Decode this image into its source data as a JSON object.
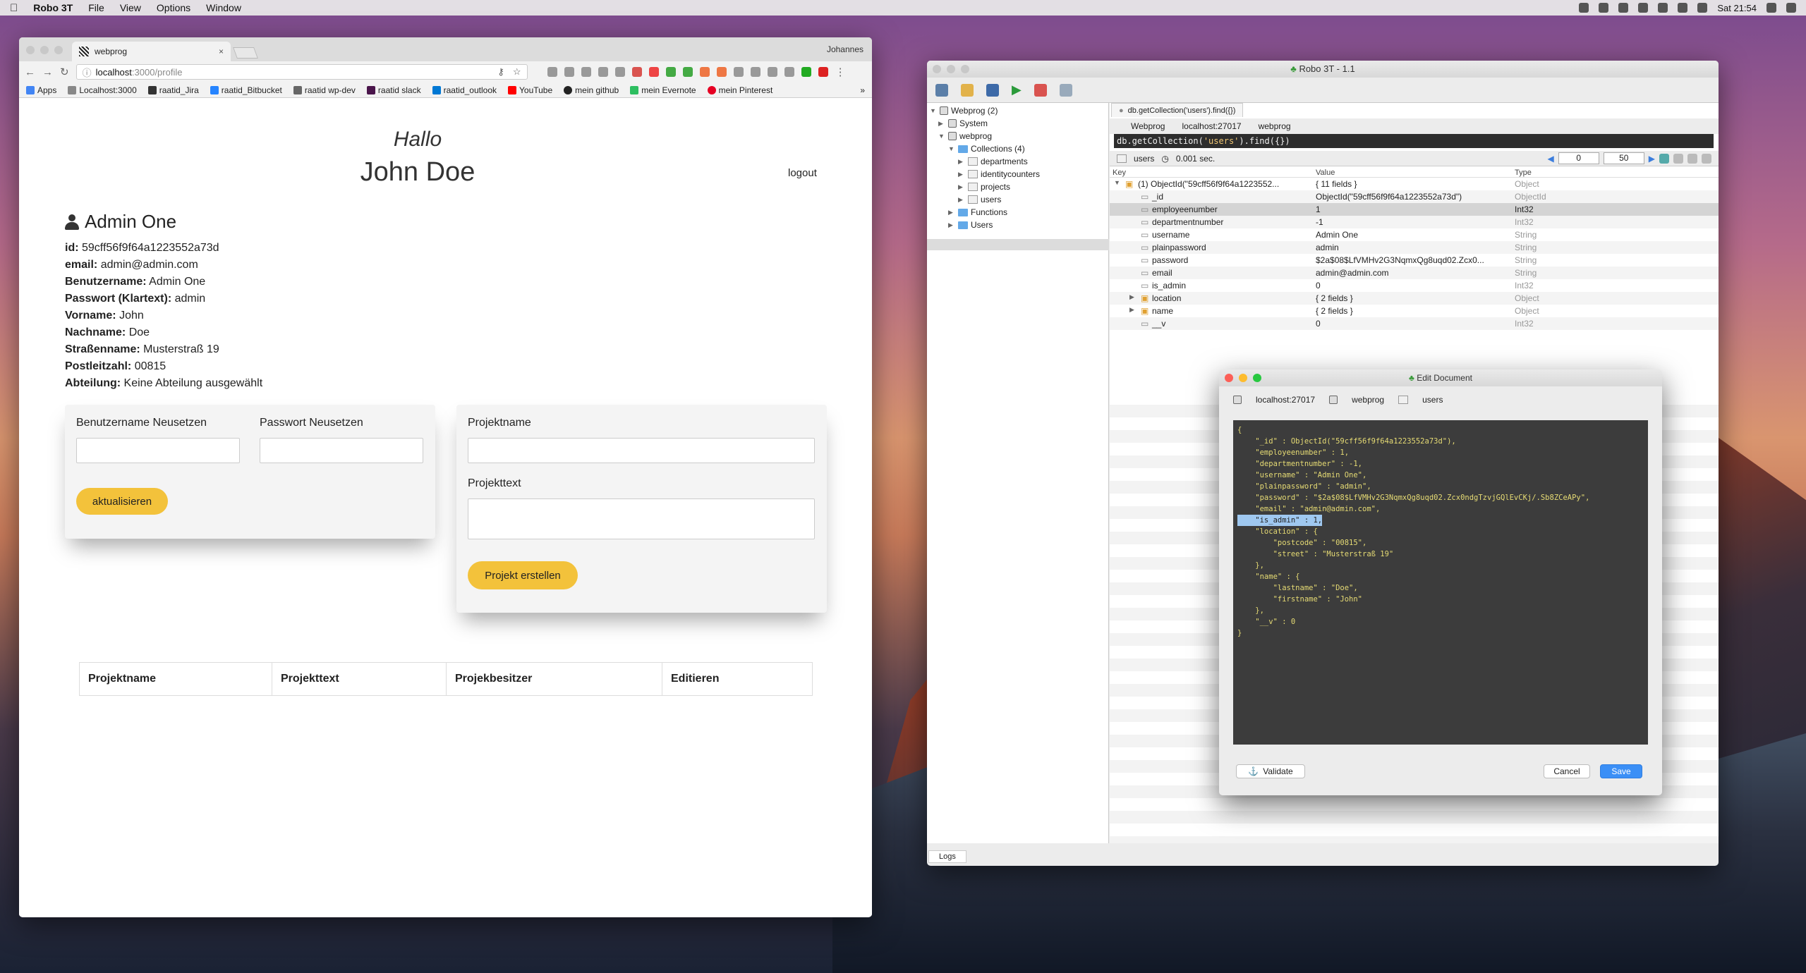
{
  "menubar": {
    "app": "Robo 3T",
    "items": [
      "File",
      "View",
      "Options",
      "Window"
    ],
    "clock": "Sat 21:54"
  },
  "browser": {
    "tab_title": "webprog",
    "user": "Johannes",
    "url_host": "localhost",
    "url_path": ":3000/profile",
    "bookmarks": [
      "Apps",
      "Localhost:3000",
      "raatid_Jira",
      "raatid_Bitbucket",
      "raatid wp-dev",
      "raatid slack",
      "raatid_outlook",
      "YouTube",
      "mein github",
      "mein Evernote",
      "mein Pinterest"
    ],
    "bookmark_colors": [
      "#4285f4",
      "#888888",
      "#333333",
      "#2684ff",
      "#666666",
      "#4a154b",
      "#0078d4",
      "#ff0000",
      "#222222",
      "#2dbe60",
      "#e60023"
    ]
  },
  "profile_page": {
    "greeting": "Hallo",
    "user_name": "John Doe",
    "logout": "logout",
    "heading": "Admin One",
    "fields": [
      {
        "label": "id:",
        "value": "59cff56f9f64a1223552a73d"
      },
      {
        "label": "email:",
        "value": "admin@admin.com"
      },
      {
        "label": "Benutzername:",
        "value": "Admin One"
      },
      {
        "label": "Passwort (Klartext):",
        "value": "admin"
      },
      {
        "label": "Vorname:",
        "value": "John"
      },
      {
        "label": "Nachname:",
        "value": "Doe"
      },
      {
        "label": "Straßenname:",
        "value": "Musterstraß 19"
      },
      {
        "label": "Postleitzahl:",
        "value": "00815"
      },
      {
        "label": "Abteilung:",
        "value": "Keine Abteilung ausgewählt"
      }
    ],
    "reset_form": {
      "username_label": "Benutzername Neusetzen",
      "password_label": "Passwort Neusetzen",
      "button": "aktualisieren"
    },
    "project_form": {
      "name_label": "Projektname",
      "text_label": "Projekttext",
      "button": "Projekt erstellen"
    },
    "table_headers": [
      "Projektname",
      "Projekttext",
      "Projekbesitzer",
      "Editieren"
    ]
  },
  "robo": {
    "title": "Robo 3T - 1.1",
    "tree": {
      "root": "Webprog (2)",
      "system": "System",
      "db": "webprog",
      "collections": "Collections (4)",
      "collection_items": [
        "departments",
        "identitycounters",
        "projects",
        "users"
      ],
      "functions": "Functions",
      "users": "Users"
    },
    "tab": "db.getCollection('users').find({})",
    "crumbs": [
      "Webprog",
      "localhost:27017",
      "webprog"
    ],
    "query_prefix": "db.getCollection(",
    "query_arg": "'users'",
    "query_suffix": ").find({})",
    "status_collection": "users",
    "status_time": "0.001 sec.",
    "pager_from": "0",
    "pager_to": "50",
    "columns": [
      "Key",
      "Value",
      "Type"
    ],
    "rows": [
      {
        "key": "(1) ObjectId(\"59cff56f9f64a1223552...",
        "value": "{ 11 fields }",
        "type": "Object"
      },
      {
        "key": "_id",
        "value": "ObjectId(\"59cff56f9f64a1223552a73d\")",
        "type": "ObjectId"
      },
      {
        "key": "employeenumber",
        "value": "1",
        "type": "Int32"
      },
      {
        "key": "departmentnumber",
        "value": "-1",
        "type": "Int32"
      },
      {
        "key": "username",
        "value": "Admin One",
        "type": "String"
      },
      {
        "key": "plainpassword",
        "value": "admin",
        "type": "String"
      },
      {
        "key": "password",
        "value": "$2a$08$LfVMHv2G3NqmxQg8uqd02.Zcx0...",
        "type": "String"
      },
      {
        "key": "email",
        "value": "admin@admin.com",
        "type": "String"
      },
      {
        "key": "is_admin",
        "value": "0",
        "type": "Int32"
      },
      {
        "key": "location",
        "value": "{ 2 fields }",
        "type": "Object"
      },
      {
        "key": "name",
        "value": "{ 2 fields }",
        "type": "Object"
      },
      {
        "key": "__v",
        "value": "0",
        "type": "Int32"
      }
    ],
    "logs": "Logs"
  },
  "dialog": {
    "title": "Edit Document",
    "crumbs": [
      "localhost:27017",
      "webprog",
      "users"
    ],
    "lines": [
      "{",
      "    \"_id\" : ObjectId(\"59cff56f9f64a1223552a73d\"),",
      "    \"employeenumber\" : 1,",
      "    \"departmentnumber\" : -1,",
      "    \"username\" : \"Admin One\",",
      "    \"plainpassword\" : \"admin\",",
      "    \"password\" : \"$2a$08$LfVMHv2G3NqmxQg8uqd02.Zcx0ndgTzvjGQlEvCKj/.Sb8ZCeAPy\",",
      "    \"email\" : \"admin@admin.com\",",
      "    \"is_admin\" : 1,",
      "    \"location\" : {",
      "        \"postcode\" : \"00815\",",
      "        \"street\" : \"Musterstraß 19\"",
      "    },",
      "    \"name\" : {",
      "        \"lastname\" : \"Doe\",",
      "        \"firstname\" : \"John\"",
      "    },",
      "    \"__v\" : 0",
      "}"
    ],
    "validate": "Validate",
    "cancel": "Cancel",
    "save": "Save"
  }
}
